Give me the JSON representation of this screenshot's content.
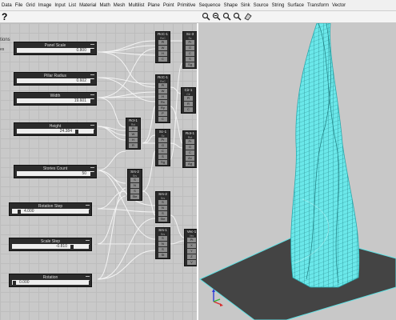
{
  "menu": [
    "Data",
    "File",
    "Grid",
    "Image",
    "Input",
    "List",
    "Material",
    "Math",
    "Mesh",
    "Multilist",
    "Plane",
    "Point",
    "Primitive",
    "Sequence",
    "Shape",
    "Sink",
    "Source",
    "String",
    "Surface",
    "Transform",
    "Vector"
  ],
  "toolbar": {
    "help_glyph": "?"
  },
  "canvas": {
    "label_partial": "tions",
    "label_partial2": "es"
  },
  "sliders": {
    "panel_scale": {
      "title": "Panel Scale",
      "value": "0.800"
    },
    "pillar_radius": {
      "title": "Pillar Radius",
      "value": "0.602"
    },
    "width": {
      "title": "Width",
      "value": "19.601"
    },
    "height": {
      "title": "Height",
      "value": "24.384"
    },
    "stories_count": {
      "title": "Stories Count",
      "value": "50"
    },
    "rotation_step": {
      "title": "Rotation Step",
      "value": "4.000"
    },
    "scale_step": {
      "title": "Scale Step",
      "value": "-0.810"
    },
    "rotation": {
      "title": "Rotation",
      "value": "0.000"
    }
  },
  "nodes": {
    "rct_1": {
      "title": "RcC-1",
      "sub": "RcC",
      "pins": [
        "Pl",
        "W",
        "H",
        "C"
      ]
    },
    "sc_3": {
      "title": "Sc-3",
      "sub": "Sc",
      "pins": [
        "Pr",
        "G",
        "C",
        "S",
        "Sg"
      ]
    },
    "rct_2": {
      "title": "RcC-1",
      "sub": "RcC",
      "pins": [
        "Pl",
        "W",
        "H",
        "Rx",
        "Ry",
        "P",
        "C"
      ]
    },
    "cir_1": {
      "title": "Cir-1",
      "sub": "Cir",
      "pins": [
        "Pl",
        "R",
        "C"
      ]
    },
    "rct_3": {
      "title": "Rct-1",
      "sub": "Rct",
      "pins": [
        "Pl",
        "W",
        "H",
        "R"
      ]
    },
    "sc_1": {
      "title": "Sc-1",
      "sub": "Sc",
      "pins": [
        "Pr",
        "G",
        "C",
        "S",
        "Sg"
      ]
    },
    "rot_1": {
      "title": "Rot-1",
      "sub": "Rot",
      "pins": [
        "Pr",
        "G",
        "C",
        "Ax",
        "Ag"
      ]
    },
    "srs_2": {
      "title": "Srs-2",
      "sub": "Srs",
      "pins": [
        "S",
        "N",
        "S",
        "Ste"
      ]
    },
    "srs_3": {
      "title": "Srs-2",
      "sub": "Srs",
      "pins": [
        "S",
        "N",
        "S",
        "Ste"
      ]
    },
    "srs_1": {
      "title": "Srs-1",
      "sub": "Srs",
      "pins": [
        "S",
        "N",
        "S",
        "St"
      ]
    },
    "vec_1": {
      "title": "Vec-1",
      "sub": "Vec",
      "pins": [
        "Pt",
        "X",
        "Y",
        "Z",
        "V"
      ]
    }
  },
  "viewport": {
    "tower_color": "#66e5e8",
    "ground_color": "#444444"
  }
}
